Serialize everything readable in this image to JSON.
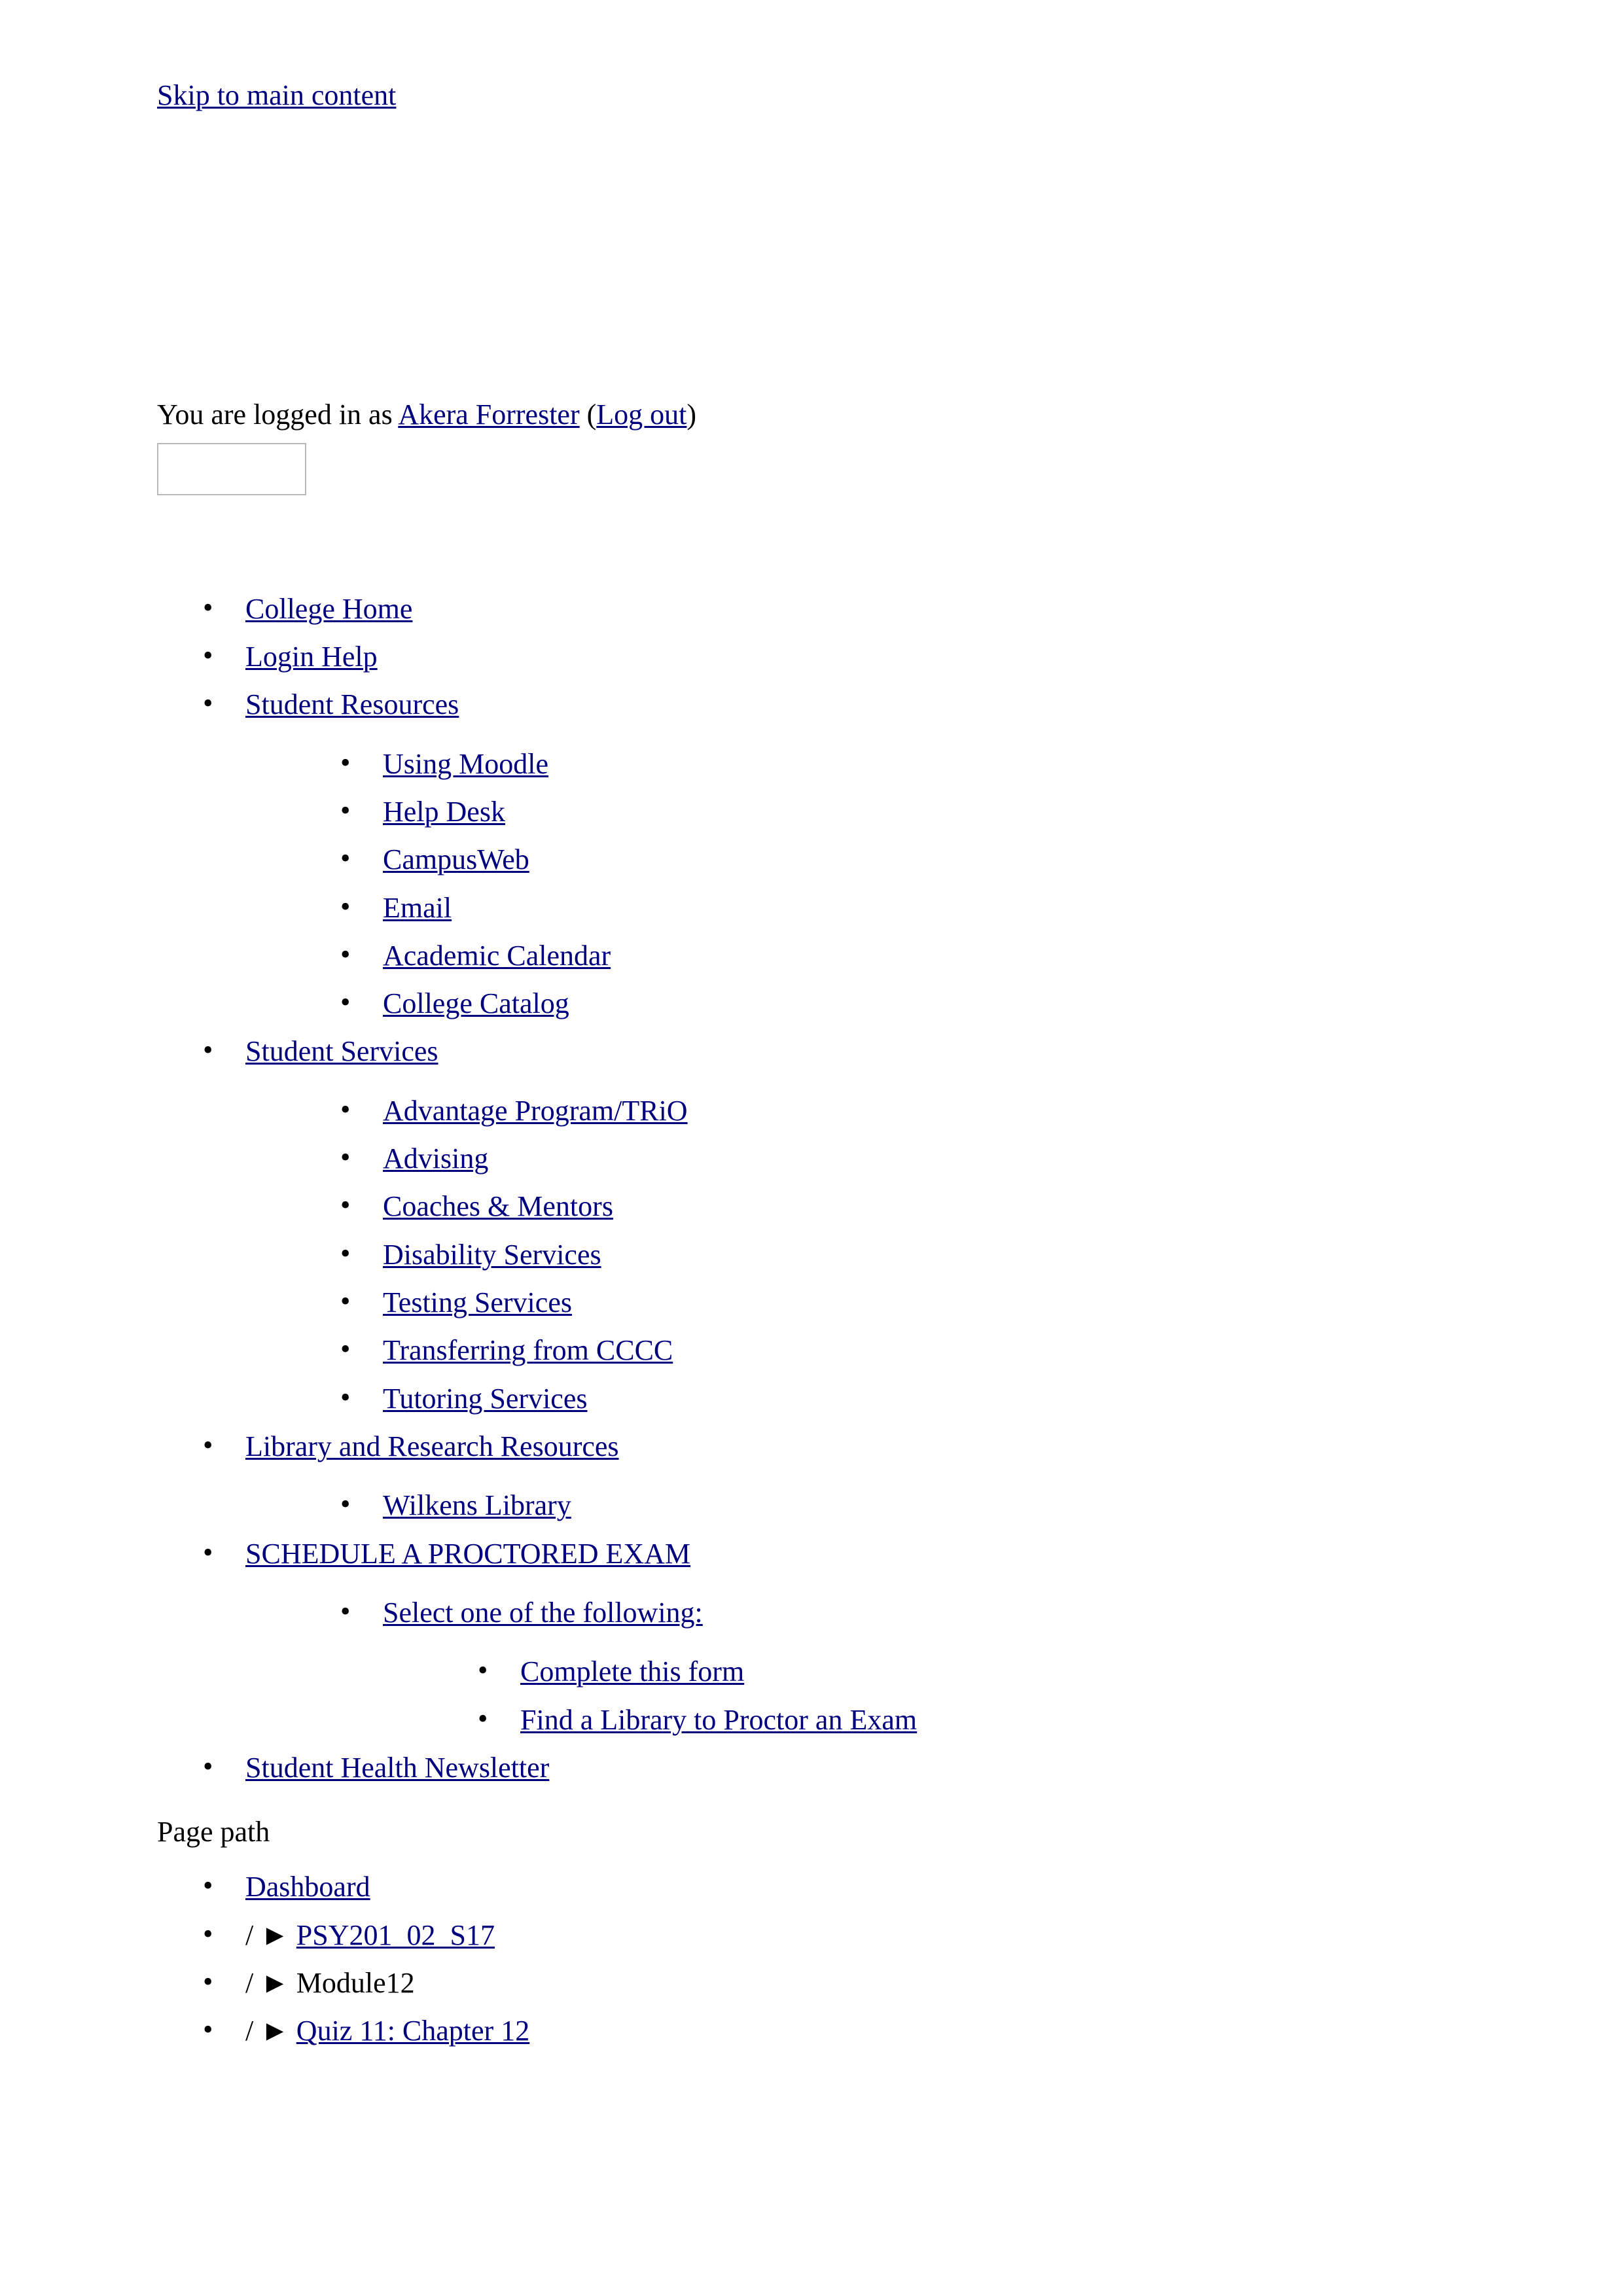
{
  "accessibility": {
    "skip_link": "Skip to main content"
  },
  "user_menu": {
    "prefix": "You are logged in as",
    "user_name": "Akera Forrester",
    "open_paren": "(",
    "logout_label": "Log out",
    "close_paren": ")"
  },
  "custom_menu": {
    "items": [
      {
        "label": "College Home",
        "link": true,
        "children": []
      },
      {
        "label": "Login Help",
        "link": true,
        "children": []
      },
      {
        "label": "Student Resources",
        "link": true,
        "children": [
          {
            "label": "Using Moodle",
            "link": true,
            "children": []
          },
          {
            "label": "Help Desk",
            "link": true,
            "children": []
          },
          {
            "label": "CampusWeb",
            "link": true,
            "children": []
          },
          {
            "label": "Email",
            "link": true,
            "children": []
          },
          {
            "label": "Academic Calendar",
            "link": true,
            "children": []
          },
          {
            "label": "College Catalog",
            "link": true,
            "children": []
          }
        ]
      },
      {
        "label": "Student Services",
        "link": true,
        "children": [
          {
            "label": "Advantage Program/TRiO",
            "link": true,
            "children": []
          },
          {
            "label": "Advising",
            "link": true,
            "children": []
          },
          {
            "label": "Coaches & Mentors",
            "link": true,
            "children": []
          },
          {
            "label": "Disability Services",
            "link": true,
            "children": []
          },
          {
            "label": "Testing Services",
            "link": true,
            "children": []
          },
          {
            "label": "Transferring from CCCC",
            "link": true,
            "children": []
          },
          {
            "label": "Tutoring Services",
            "link": true,
            "children": []
          }
        ]
      },
      {
        "label": "Library and Research Resources",
        "link": true,
        "children": [
          {
            "label": "Wilkens Library",
            "link": true,
            "children": []
          }
        ]
      },
      {
        "label": "SCHEDULE A PROCTORED EXAM",
        "link": true,
        "children": [
          {
            "label": "Select one of the following:",
            "link": true,
            "children": [
              {
                "label": "Complete this form",
                "link": true,
                "children": []
              },
              {
                "label": "Find a Library to Proctor an Exam",
                "link": true,
                "children": []
              }
            ]
          }
        ]
      },
      {
        "label": "Student Health Newsletter",
        "link": true,
        "children": []
      }
    ]
  },
  "breadcrumb": {
    "heading": "Page path",
    "separator": "/",
    "arrow": "►",
    "items": [
      {
        "label": "Dashboard",
        "link": true,
        "show_separator": false
      },
      {
        "label": "PSY201_02_S17",
        "link": true,
        "show_separator": true
      },
      {
        "label": "Module12",
        "link": false,
        "show_separator": true
      },
      {
        "label": "Quiz 11: Chapter 12",
        "link": true,
        "show_separator": true
      }
    ]
  },
  "theme": {
    "link_color": "#00007f",
    "text_color": "#000000",
    "background": "#ffffff",
    "placeholder_border": "#b9b9b9"
  }
}
